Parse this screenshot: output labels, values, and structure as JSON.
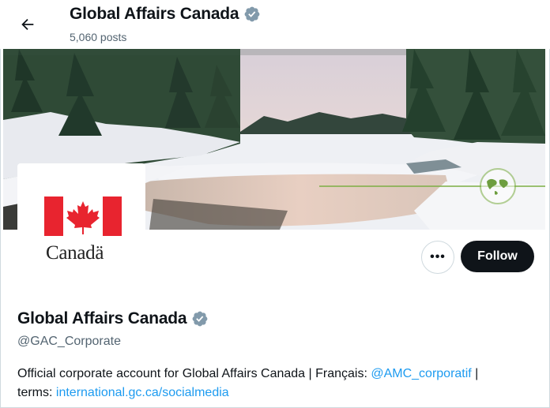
{
  "header": {
    "title": "Global Affairs Canada",
    "posts": "5,060 posts"
  },
  "banner": {
    "description": ""
  },
  "avatar": {
    "wordmark": "Canadä"
  },
  "actions": {
    "more_label": "•••",
    "follow_label": "Follow"
  },
  "profile": {
    "name": "Global Affairs Canada",
    "handle": "@GAC_Corporate",
    "bio_prefix": "Official corporate account for Global Affairs Canada | Français: ",
    "bio_mention": "@AMC_corporatif",
    "bio_middle": " |",
    "bio_terms": "terms: ",
    "bio_link": "international.gc.ca/socialmedia"
  },
  "colors": {
    "accent": "#1d9bf0",
    "follow_bg": "#0f1419",
    "verified": "#829aab",
    "flag_red": "#e8242f"
  }
}
